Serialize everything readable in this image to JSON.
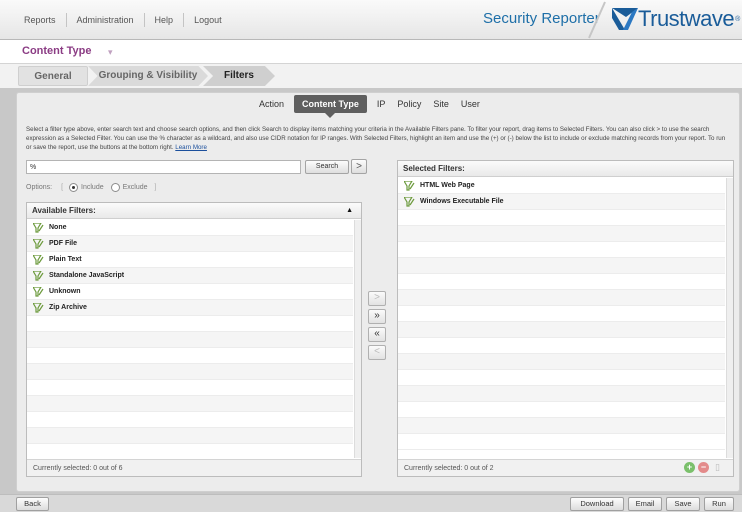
{
  "topnav": {
    "items": [
      "Reports",
      "Administration",
      "Help",
      "Logout"
    ]
  },
  "product": {
    "name": "Security Reporter",
    "logo_text": "Trustwave",
    "logo_mark": "®"
  },
  "header": {
    "title": "Content Type",
    "caret": "▾"
  },
  "main_tabs": [
    {
      "label": "General"
    },
    {
      "label": "Grouping & Visibility"
    },
    {
      "label": "Filters"
    }
  ],
  "sub_tabs": [
    {
      "label": "Action"
    },
    {
      "label": "Content Type"
    },
    {
      "label": "IP"
    },
    {
      "label": "Policy"
    },
    {
      "label": "Site"
    },
    {
      "label": "User"
    }
  ],
  "instructions": {
    "text": "Select a filter type above, enter search text and choose search options, and then click Search to display items matching your criteria in the Available Filters pane. To filter your report, drag items to Selected Filters. You can also click > to use the search expression as a Selected Filter. You can use the % character as a wildcard, and also use CIDR notation for IP ranges. With Selected Filters, highlight an item and use the (+) or (-) below the list to include or exclude matching records from your report. To run or save the report, use the buttons at the bottom right.",
    "link": "Learn More"
  },
  "search": {
    "value": "%",
    "button": "Search",
    "go": ">"
  },
  "options": {
    "label": "Options:",
    "bracket_open": "[",
    "bracket_close": "]",
    "include": "Include",
    "exclude": "Exclude"
  },
  "available": {
    "header": "Available Filters:",
    "sort": "▲",
    "items": [
      "None",
      "PDF File",
      "Plain Text",
      "Standalone JavaScript",
      "Unknown",
      "Zip Archive"
    ],
    "footer": "Currently selected: 0 out of 6"
  },
  "selected": {
    "header": "Selected Filters:",
    "items": [
      "HTML Web Page",
      "Windows Executable File"
    ],
    "footer": "Currently selected: 0 out of 2"
  },
  "transfer_buttons": [
    ">",
    "»",
    "«",
    "<"
  ],
  "footer_icons": {
    "add": "+",
    "remove": "−",
    "trash": "▯"
  },
  "bottom_buttons": {
    "back": "Back",
    "download": "Download",
    "email": "Email",
    "save": "Save",
    "run": "Run"
  },
  "colors": {
    "brand_blue": "#1a5c99",
    "header_purple": "#8b3c84",
    "active_subtab": "#5f5f5f",
    "filter_icon_green": "#6c9a3c"
  }
}
